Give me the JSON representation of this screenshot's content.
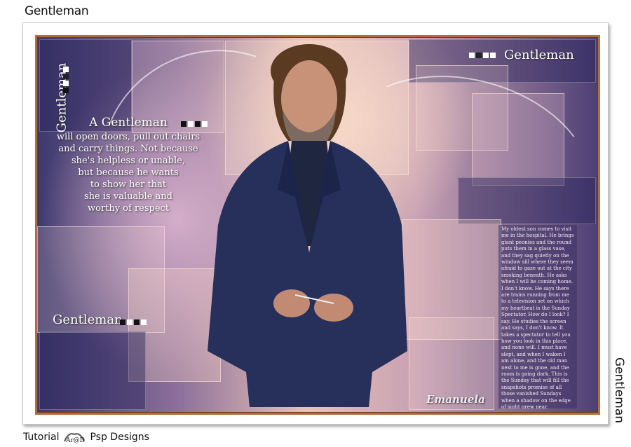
{
  "page": {
    "top_title": "Gentleman",
    "side_title": "Gentleman",
    "credit_prefix": "Tutorial",
    "credit_logo_text": "Ar@D",
    "credit_suffix": "Psp Designs"
  },
  "poster": {
    "vertical_label": "Gentleman",
    "top_right_label": "Gentleman",
    "bottom_left_label": "Gentleman",
    "quote": {
      "title": "A Gentleman",
      "lines": [
        "will open doors, pull out chairs",
        "and carry things.  Not because",
        "she's helpless or unable,",
        "but because he wants",
        "to show her that",
        "she is valuable and",
        "worthy of respect"
      ]
    },
    "body_text": "My oldest son comes to visit me in the hospital. He brings giant peonies and the round puts them in a glass vase, and they sag quietly on the window sill where they seem afraid to gaze out at the city smoking beneath. He asks when I will be coming home. I don't know. He says there are trains running from me to a television set on which my heartbeat is the Sunday Spectator. How do I look? I say. He studies the screen and says, I don't know. It takes a spectator to tell you how you look in this place, and none will. I must have slept, and when I waken I am alone, and the old man next to me is gone, and the room is going dark. This is the Sunday that will fill the snapshots promise of all those vanished Sundays when a shadow on the edge of sight grew near, enormous, hesitated, and left, and I sighed with weariness knowing our more work was here to live. At last a time and place to the art given me, and even a small reason. The flowers have turned now that the windows have gone dark, and I see their pale faces in the soft mirror of the glass. No. They aren't crying for this is not the vale of tears; they are quietly laughing at flowers",
    "signature": "Emanuela",
    "colors": {
      "frame": "#b96a3a",
      "navy": "#3d3a6e",
      "peach": "#e8c3b6",
      "suit": "#26305a"
    }
  }
}
